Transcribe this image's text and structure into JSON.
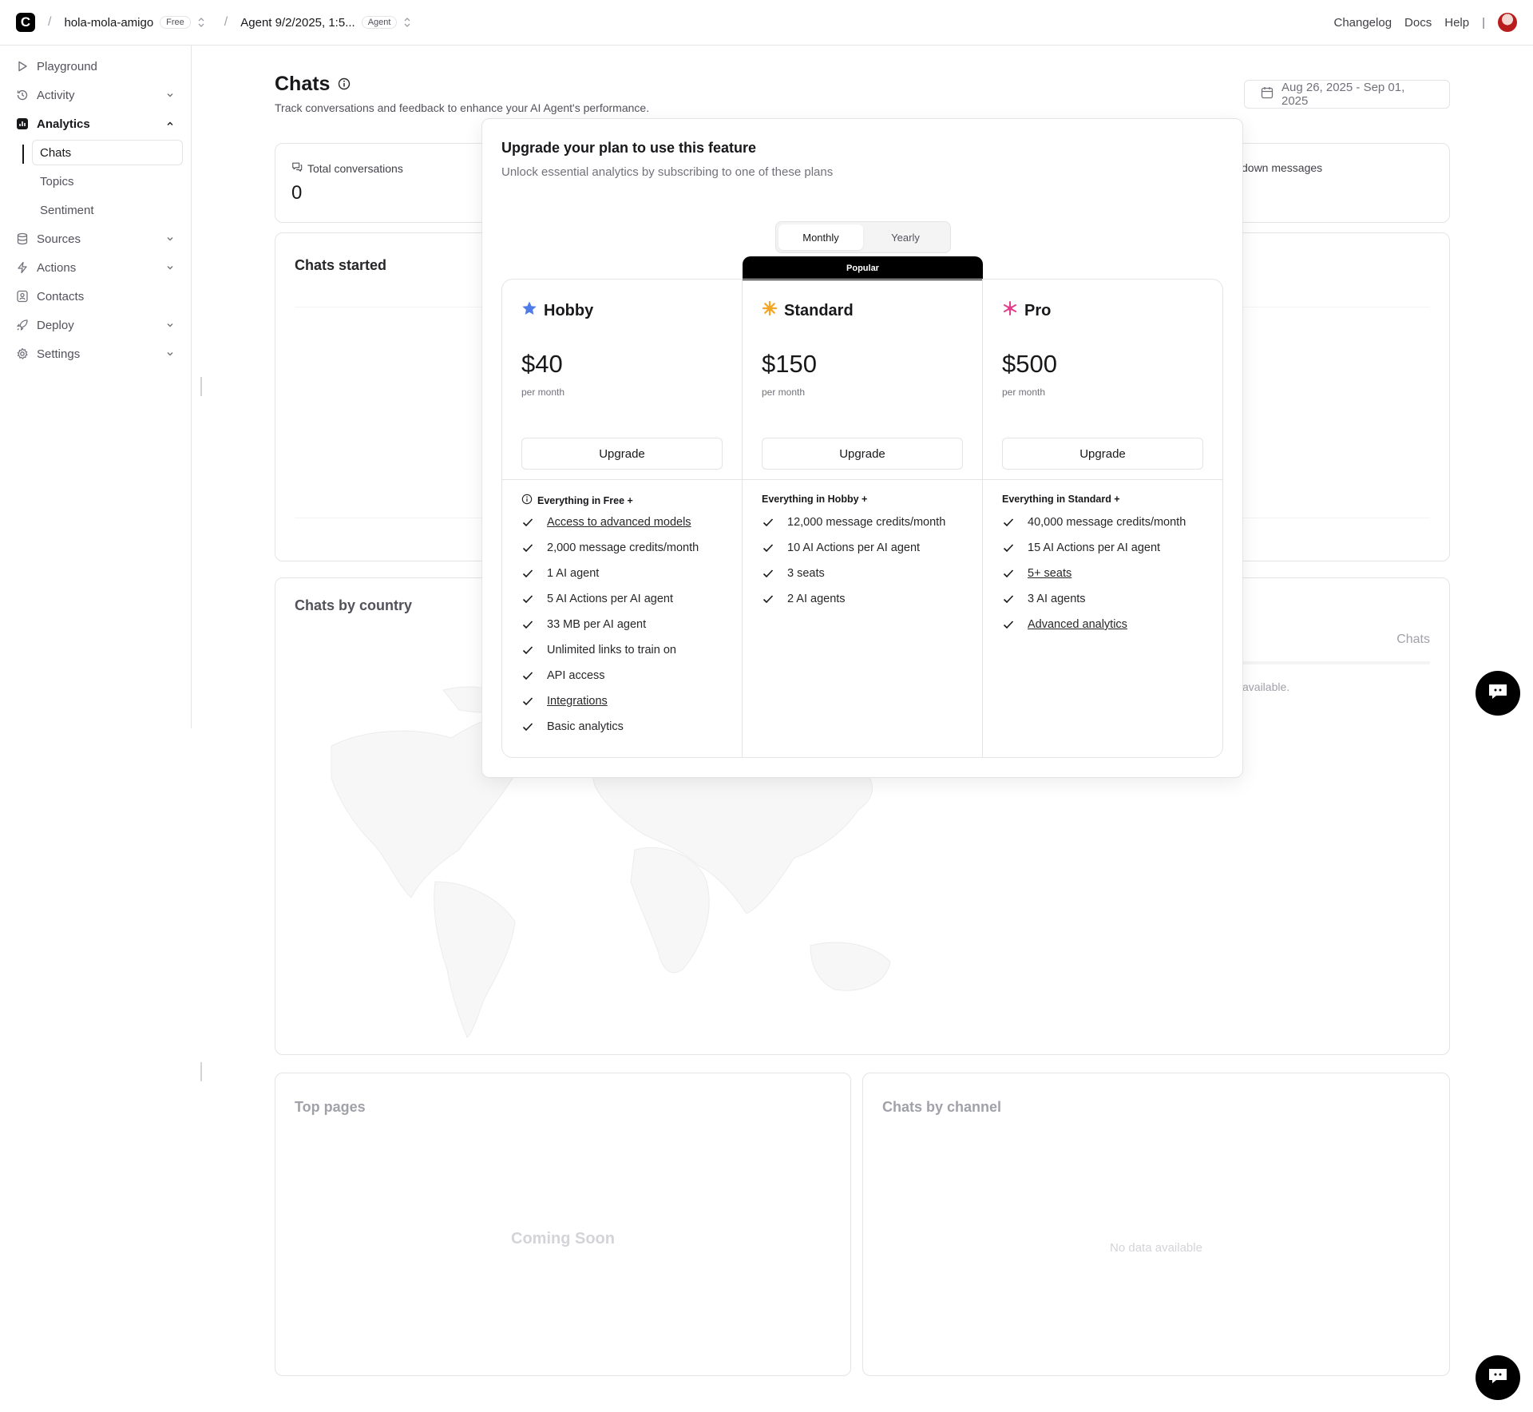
{
  "topbar": {
    "logo_letter": "C",
    "workspace": "hola-mola-amigo",
    "workspace_tag": "Free",
    "agent": "Agent 9/2/2025, 1:5...",
    "agent_tag": "Agent",
    "links": [
      "Changelog",
      "Docs",
      "Help"
    ],
    "separator": "|"
  },
  "sidebar": {
    "items": [
      {
        "label": "Playground"
      },
      {
        "label": "Activity"
      },
      {
        "label": "Analytics"
      },
      {
        "label": "Sources"
      },
      {
        "label": "Actions"
      },
      {
        "label": "Contacts"
      },
      {
        "label": "Deploy"
      },
      {
        "label": "Settings"
      }
    ],
    "analytics_sub": [
      "Chats",
      "Topics",
      "Sentiment"
    ]
  },
  "page": {
    "title": "Chats",
    "subtitle": "Track conversations and feedback to enhance your AI Agent's performance.",
    "date_range": "Aug 26, 2025 - Sep 01, 2025"
  },
  "stats": {
    "total_conversations_label": "Total conversations",
    "total_conversations_value": "0",
    "thumbs_down_label": "down messages"
  },
  "cards": {
    "chats_started": "Chats started",
    "chats_by_country": "Chats by country",
    "country_col": "Chats",
    "country_empty": "available.",
    "top_pages": "Top pages",
    "top_pages_body": "Coming Soon",
    "chats_by_channel": "Chats by channel",
    "channel_body": "No data available"
  },
  "modal": {
    "title": "Upgrade your plan to use this feature",
    "subtitle": "Unlock essential analytics by subscribing to one of these plans",
    "toggle": {
      "monthly": "Monthly",
      "yearly": "Yearly",
      "selected": "Monthly"
    },
    "popular": "Popular",
    "plans": [
      {
        "name": "Hobby",
        "icon": "star-icon",
        "color": "#4f7be8",
        "price": "$40",
        "period": "per month",
        "button": "Upgrade",
        "intro": "Everything in Free +",
        "features": [
          "Access to advanced models",
          "2,000 message credits/month",
          "1 AI agent",
          "5 AI Actions per AI agent",
          "33 MB per AI agent",
          "Unlimited links to train on",
          "API access",
          "Integrations",
          "Basic analytics"
        ]
      },
      {
        "name": "Standard",
        "icon": "sun-icon",
        "color": "#f5a524",
        "price": "$150",
        "period": "per month",
        "button": "Upgrade",
        "intro": "Everything in Hobby +",
        "features": [
          "12,000 message credits/month",
          "10 AI Actions per AI agent",
          "3 seats",
          "2 AI agents"
        ]
      },
      {
        "name": "Pro",
        "icon": "sparkle-icon",
        "color": "#e33e8c",
        "price": "$500",
        "period": "per month",
        "button": "Upgrade",
        "intro": "Everything in Standard +",
        "features": [
          "40,000 message credits/month",
          "15 AI Actions per AI agent",
          "5+ seats",
          "3 AI agents",
          "Advanced analytics"
        ]
      }
    ]
  }
}
